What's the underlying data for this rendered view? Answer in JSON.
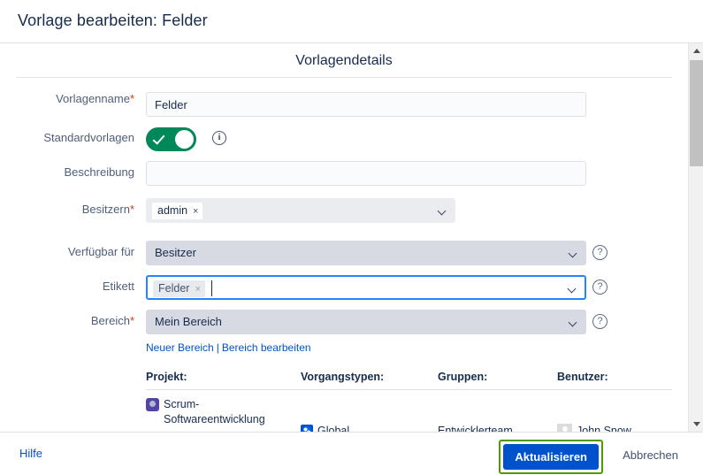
{
  "dialog": {
    "title": "Vorlage bearbeiten: Felder",
    "section_title": "Vorlagendetails"
  },
  "form": {
    "template_name": {
      "label": "Vorlagenname",
      "required": "*",
      "value": "Felder"
    },
    "default_templates": {
      "label": "Standardvorlagen",
      "toggle_on": true,
      "info_icon": "info-icon"
    },
    "description": {
      "label": "Beschreibung",
      "value": "",
      "placeholder": ""
    },
    "owners": {
      "label": "Besitzern",
      "required": "*",
      "chips": [
        {
          "text": "admin",
          "remove": "×"
        }
      ]
    },
    "available_for": {
      "label": "Verfügbar für",
      "value": "Besitzer",
      "help_icon": "help-icon"
    },
    "label_field": {
      "label": "Etikett",
      "focused": true,
      "chips": [
        {
          "text": "Felder",
          "remove": "×"
        }
      ],
      "help_icon": "help-icon"
    },
    "scope": {
      "label": "Bereich",
      "required": "*",
      "value": "Mein Bereich",
      "help_icon": "help-icon"
    },
    "scope_links": {
      "new": "Neuer Bereich",
      "separator": "|",
      "edit": "Bereich bearbeiten"
    }
  },
  "table": {
    "headers": {
      "project": "Projekt:",
      "issue_types": "Vorgangstypen:",
      "groups": "Gruppen:",
      "users": "Benutzer:"
    },
    "rows": [
      {
        "project": "Scrum-Softwareentwicklung",
        "project_icon": "project-avatar-icon",
        "issue_type": "Global",
        "issue_type_icon": "globe-icon",
        "group": "Entwicklerteam",
        "user": "John Snow",
        "user_icon": "user-avatar-icon"
      }
    ]
  },
  "footer": {
    "help": "Hilfe",
    "submit": "Aktualisieren",
    "cancel": "Abbrechen"
  },
  "scrollbar": {
    "up_icon": "chevron-up-icon",
    "down_icon": "chevron-down-icon"
  },
  "colors": {
    "accent": "#0052cc",
    "toggle_on": "#00875a",
    "required": "#de350b",
    "focus_ring": "#2684ff",
    "highlight": "#4e9a06"
  }
}
